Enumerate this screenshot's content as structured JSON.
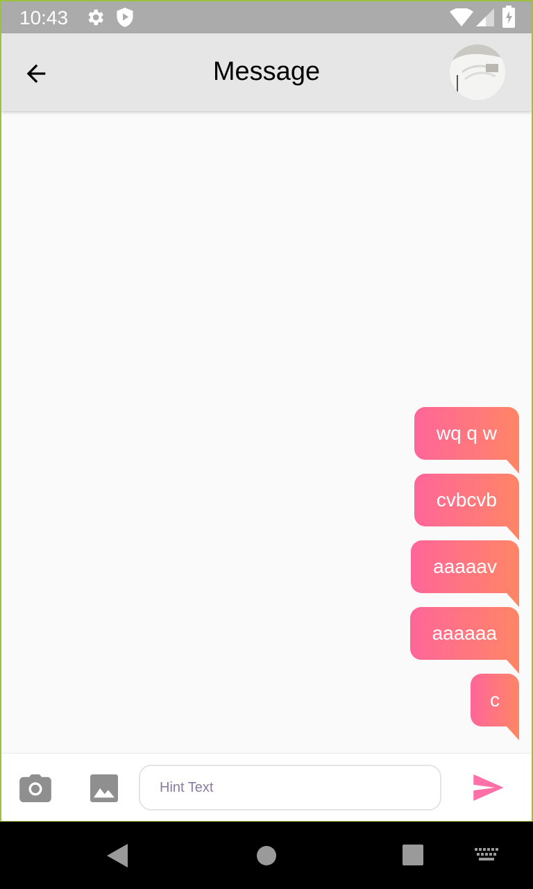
{
  "status_bar": {
    "time": "10:43",
    "icons": [
      "gear-icon",
      "shield-play-icon",
      "wifi-icon",
      "signal-icon",
      "battery-charging-icon"
    ]
  },
  "app_bar": {
    "title": "Message",
    "back_icon": "arrow-back-icon",
    "avatar": "profile-avatar"
  },
  "messages": [
    {
      "text": "wq q w",
      "from": "me"
    },
    {
      "text": "cvbcvb",
      "from": "me"
    },
    {
      "text": "aaaaav",
      "from": "me"
    },
    {
      "text": "aaaaaa",
      "from": "me"
    },
    {
      "text": "c",
      "from": "me"
    }
  ],
  "composer": {
    "placeholder": "Hint Text",
    "value": "",
    "camera_icon": "camera-icon",
    "gallery_icon": "image-icon",
    "send_icon": "send-icon"
  },
  "colors": {
    "bubble_start": "#ff6699",
    "bubble_end": "#ff8566",
    "send": "#ff6fa8",
    "app_bar": "#e6e6e6"
  }
}
